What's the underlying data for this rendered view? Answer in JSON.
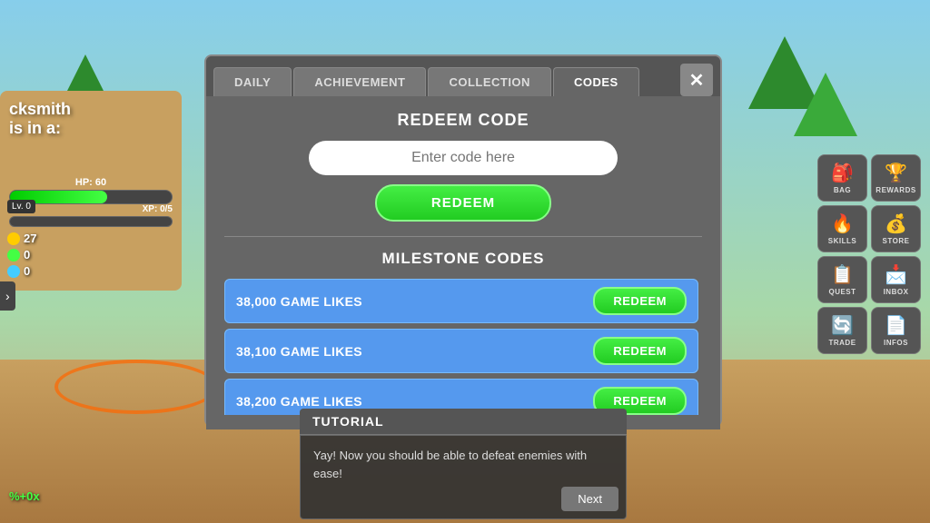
{
  "background": {
    "sky_color": "#87ceeb",
    "ground_color": "#c8a060"
  },
  "left_sign": {
    "line1": "cksmith",
    "line2": "is in a:"
  },
  "player_stats": {
    "hp_label": "HP: 60",
    "xp_label": "XP: 0/5",
    "level_label": "Lv. 0",
    "coins": "27",
    "stat1": "0",
    "stat2": "0"
  },
  "percent_indicator": {
    "label": "%+0x"
  },
  "hud": {
    "buttons": [
      {
        "label": "BAG",
        "icon": "🎒"
      },
      {
        "label": "REWARDS",
        "icon": "🏆"
      },
      {
        "label": "SKILLS",
        "icon": "🔥"
      },
      {
        "label": "STORE",
        "icon": "💰"
      },
      {
        "label": "QUEST",
        "icon": "📋"
      },
      {
        "label": "INBOX",
        "icon": "📩"
      },
      {
        "label": "TRADE",
        "icon": "🔄"
      },
      {
        "label": "INFOS",
        "icon": "📄"
      }
    ]
  },
  "modal": {
    "tabs": [
      {
        "label": "DAILY",
        "active": false
      },
      {
        "label": "ACHIEVEMENT",
        "active": false
      },
      {
        "label": "COLLECTION",
        "active": false
      },
      {
        "label": "CODES",
        "active": true
      }
    ],
    "close_label": "✕",
    "redeem_section": {
      "title": "REDEEM CODE",
      "input_placeholder": "Enter code here",
      "redeem_button_label": "REDEEM"
    },
    "milestone_section": {
      "title": "MILESTONE CODES",
      "items": [
        {
          "label": "38,000 GAME LIKES",
          "button_label": "REDEEM"
        },
        {
          "label": "38,100 GAME LIKES",
          "button_label": "REDEEM"
        },
        {
          "label": "38,200 GAME LIKES",
          "button_label": "REDEEM"
        }
      ]
    }
  },
  "tutorial": {
    "header": "TUTORIAL",
    "body_text": "Yay! Now you should be able to defeat enemies with ease!",
    "next_button_label": "Next"
  }
}
